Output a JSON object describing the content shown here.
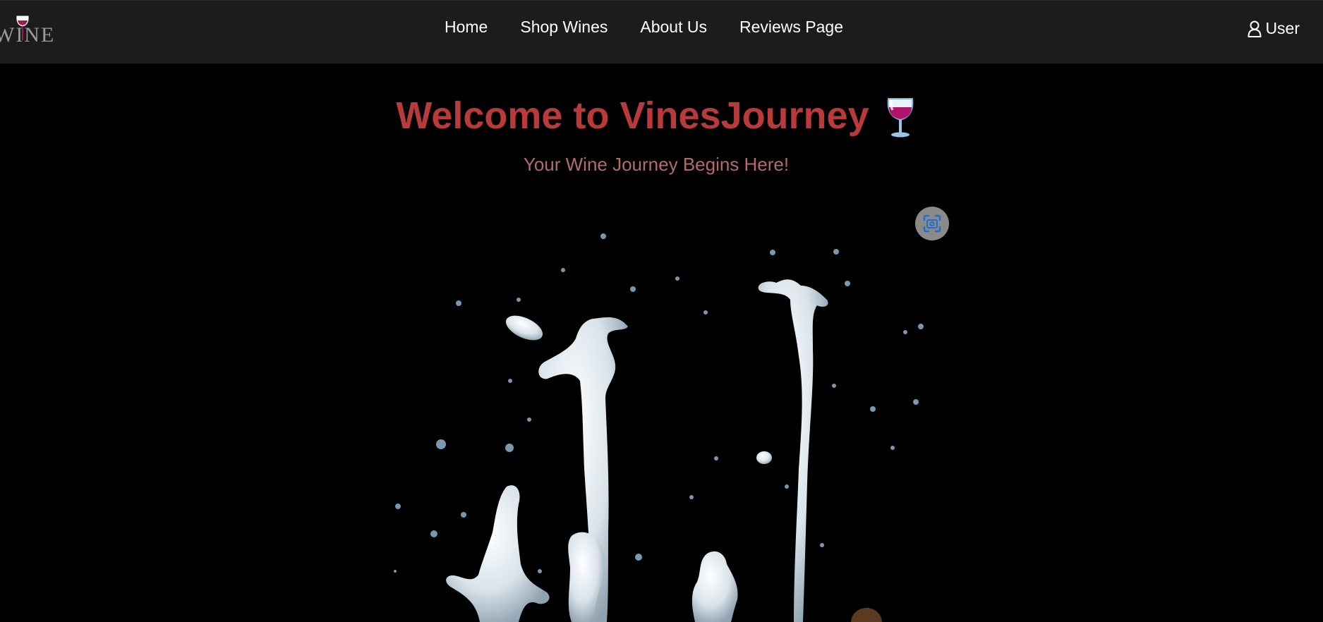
{
  "navbar": {
    "logo_text": "WINE",
    "links": [
      {
        "label": "Home"
      },
      {
        "label": "Shop Wines"
      },
      {
        "label": "About Us"
      },
      {
        "label": "Reviews Page"
      }
    ],
    "user_label": "User"
  },
  "hero": {
    "title": "Welcome to VinesJourney",
    "subtitle": "Your Wine Journey Begins Here!",
    "image_icon": "milk-splash-photo",
    "lens_icon": "visual-search-icon"
  },
  "colors": {
    "navbar_bg": "#1c1c1c",
    "page_bg": "#000000",
    "title": "#b83a3a",
    "subtitle": "#b46a6e",
    "wine": "#a0185a"
  }
}
